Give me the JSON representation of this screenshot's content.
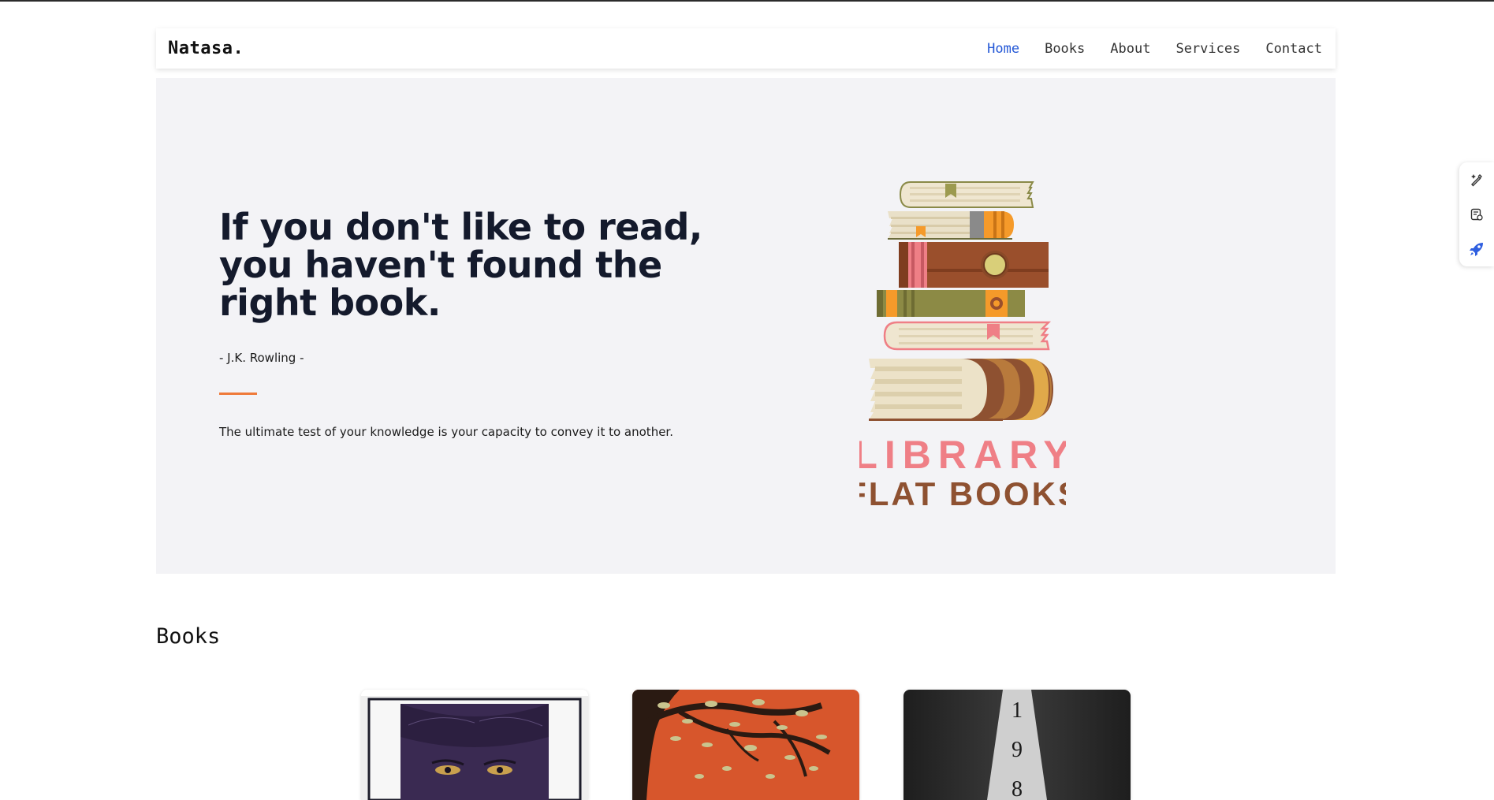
{
  "header": {
    "brand": "Natasa.",
    "nav": [
      {
        "label": "Home",
        "active": true
      },
      {
        "label": "Books",
        "active": false
      },
      {
        "label": "About",
        "active": false
      },
      {
        "label": "Services",
        "active": false
      },
      {
        "label": "Contact",
        "active": false
      }
    ]
  },
  "hero": {
    "quote_lines": [
      "If you don't like to read,",
      "you haven't found the",
      "right book."
    ],
    "author": "- J.K. Rowling -",
    "tagline": "The ultimate test of your knowledge is your capacity to convey it to another.",
    "illustration": {
      "line1": "LIBRARY",
      "line2": "FLAT BOOKS"
    },
    "accent_color": "#ef7a3a"
  },
  "books_section": {
    "title": "Books",
    "cards": [
      {
        "cover": "purple-eyes-cover"
      },
      {
        "cover": "orange-tree-cover"
      },
      {
        "cover": "dark-spotlight-cover",
        "cover_text": [
          "1",
          "9",
          "8"
        ]
      }
    ]
  },
  "side_tools": [
    {
      "icon": "magic-pen-icon"
    },
    {
      "icon": "document-settings-icon"
    },
    {
      "icon": "rocket-icon"
    }
  ],
  "colors": {
    "nav_active": "#2458d6",
    "heading": "#141a2c",
    "hero_bg": "#f3f3f6",
    "library_pink": "#ef7f86",
    "library_brown": "#8e5131"
  }
}
